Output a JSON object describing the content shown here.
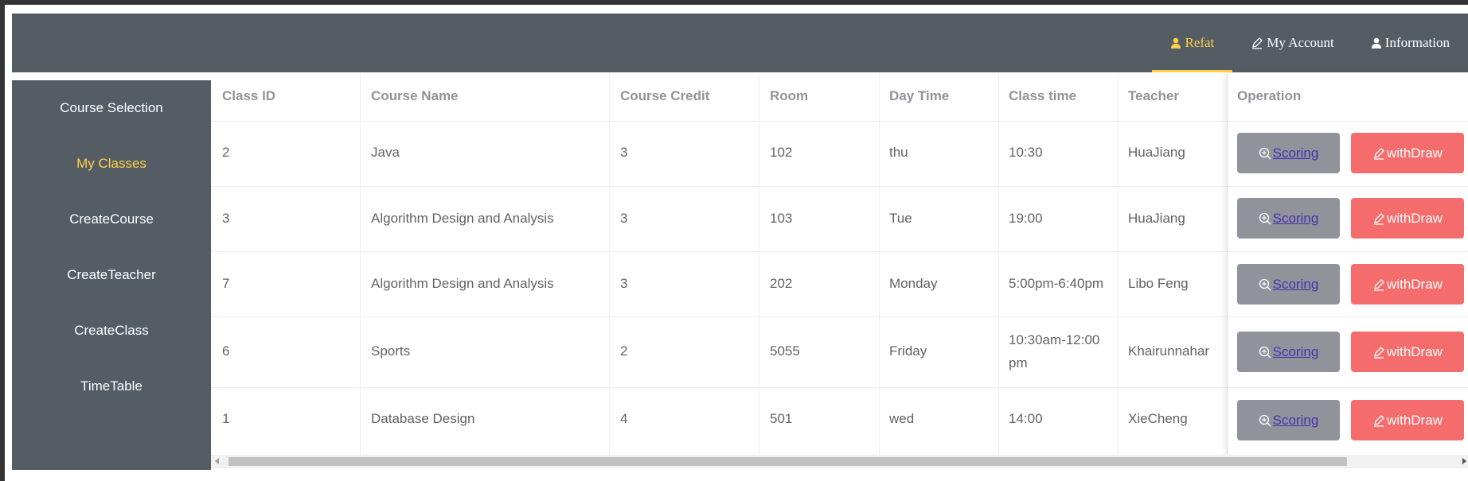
{
  "header": {
    "nav": [
      {
        "label": "Refat",
        "icon": "user-icon",
        "active": true
      },
      {
        "label": "My Account",
        "icon": "edit-icon",
        "active": false
      },
      {
        "label": "Information",
        "icon": "user-icon",
        "active": false
      }
    ]
  },
  "sidebar": {
    "items": [
      {
        "label": "Course Selection",
        "active": false
      },
      {
        "label": "My Classes",
        "active": true
      },
      {
        "label": "CreateCourse",
        "active": false
      },
      {
        "label": "CreateTeacher",
        "active": false
      },
      {
        "label": "CreateClass",
        "active": false
      },
      {
        "label": "TimeTable",
        "active": false
      }
    ]
  },
  "table": {
    "columns": [
      "Class ID",
      "Course Name",
      "Course Credit",
      "Room",
      "Day Time",
      "Class time",
      "Teacher",
      "Operation"
    ],
    "rows": [
      {
        "class_id": "2",
        "course_name": "Java",
        "credit": "3",
        "room": "102",
        "day": "thu",
        "time": "10:30",
        "teacher": "HuaJiang"
      },
      {
        "class_id": "3",
        "course_name": "Algorithm Design and Analysis",
        "credit": "3",
        "room": "103",
        "day": "Tue",
        "time": "19:00",
        "teacher": "HuaJiang"
      },
      {
        "class_id": "7",
        "course_name": "Algorithm Design and Analysis",
        "credit": "3",
        "room": "202",
        "day": "Monday",
        "time": "5:00pm-6:40pm",
        "teacher": "Libo Feng"
      },
      {
        "class_id": "6",
        "course_name": "Sports",
        "credit": "2",
        "room": "5055",
        "day": "Friday",
        "time_line1": "10:30am-12:00",
        "time_line2": "pm",
        "teacher": "Khairunnahar"
      },
      {
        "class_id": "1",
        "course_name": "Database Design",
        "credit": "4",
        "room": "501",
        "day": "wed",
        "time": "14:00",
        "teacher": "XieCheng"
      }
    ],
    "actions": {
      "scoring_label": "Scoring",
      "scoring_icon": "zoom-in-icon",
      "withdraw_label": "withDraw",
      "withdraw_icon": "edit-icon"
    }
  },
  "colors": {
    "nav_bg": "#545c64",
    "active": "#ffd04b",
    "scoring_btn": "#909399",
    "withdraw_btn": "#f56c6c"
  }
}
